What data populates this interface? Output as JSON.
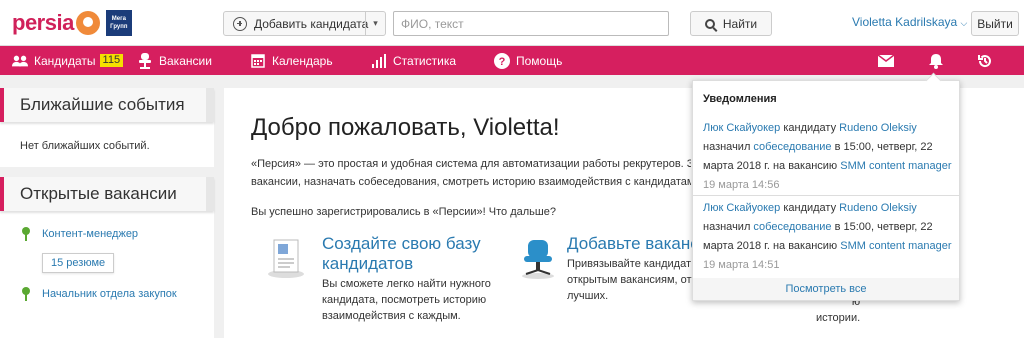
{
  "header": {
    "logo_text": "persia",
    "partner_logo_text": "Мега Групп",
    "add_candidate_label": "Добавить кандидата",
    "search_placeholder": "ФИО, текст",
    "search_button": "Найти",
    "user_name": "Violetta Kadrilskaya",
    "logout_label": "Выйти"
  },
  "nav": {
    "candidates_label": "Кандидаты",
    "candidates_count": "115",
    "vacancies_label": "Вакансии",
    "calendar_label": "Календарь",
    "stats_label": "Статистика",
    "help_label": "Помощь"
  },
  "sidebar": {
    "events_title": "Ближайшие события",
    "events_empty": "Нет ближайших событий.",
    "vacancies_title": "Открытые вакансии",
    "vacancies": [
      {
        "name": "Контент-менеджер",
        "resumes": "15 резюме"
      },
      {
        "name": "Начальник отдела закупок"
      }
    ]
  },
  "main": {
    "welcome": "Добро пожаловать, Violetta!",
    "intro_line1": "«Персия» — это простая и удобная система для автоматизации работы рекрутеров. Здесь",
    "intro_line2": "вакансии, назначать собеседования, смотреть историю взаимодействия с кандидатами.",
    "registered": "Вы успешно зарегистрировались в «Персии»! Что дальше?",
    "feature1_title_line1": "Создайте свою базу",
    "feature1_title_line2": "кандидатов",
    "feature1_desc_line1": "Вы сможете легко найти нужного",
    "feature1_desc_line2": "кандидата, посмотреть историю",
    "feature1_desc_line3": "взаимодействия с каждым.",
    "feature2_title": "Добавьте ваканс",
    "feature2_desc_line1": "Привязывайте кандидат",
    "feature2_desc_line2": "открытым вакансиям, от",
    "feature2_desc_line3": "лучших.",
    "right_partial_line1": "ы",
    "right_partial_line2": "ю",
    "right_partial_line3": "истории."
  },
  "notifications": {
    "title": "Уведомления",
    "items": [
      {
        "author": "Люк Скайуокер",
        "text1": " кандидату ",
        "candidate": "Rudeno Oleksiy",
        "text2": "назначил ",
        "event": "собеседование",
        "text3": " в 15:00, четверг, 22",
        "text4": "марта 2018 г. на вакансию ",
        "vacancy": "SMM content manager",
        "time": "19 марта 14:56"
      },
      {
        "author": "Люк Скайуокер",
        "text1": " кандидату ",
        "candidate": "Rudeno Oleksiy",
        "text2": "назначил ",
        "event": "собеседование",
        "text3": " в 15:00, четверг, 22",
        "text4": "марта 2018 г. на вакансию ",
        "vacancy": "SMM content manager",
        "time": "19 марта 14:51"
      }
    ],
    "view_all": "Посмотреть все"
  },
  "colors": {
    "brand": "#d61f5f",
    "link": "#2a7ab0",
    "badge": "#f5e000"
  }
}
